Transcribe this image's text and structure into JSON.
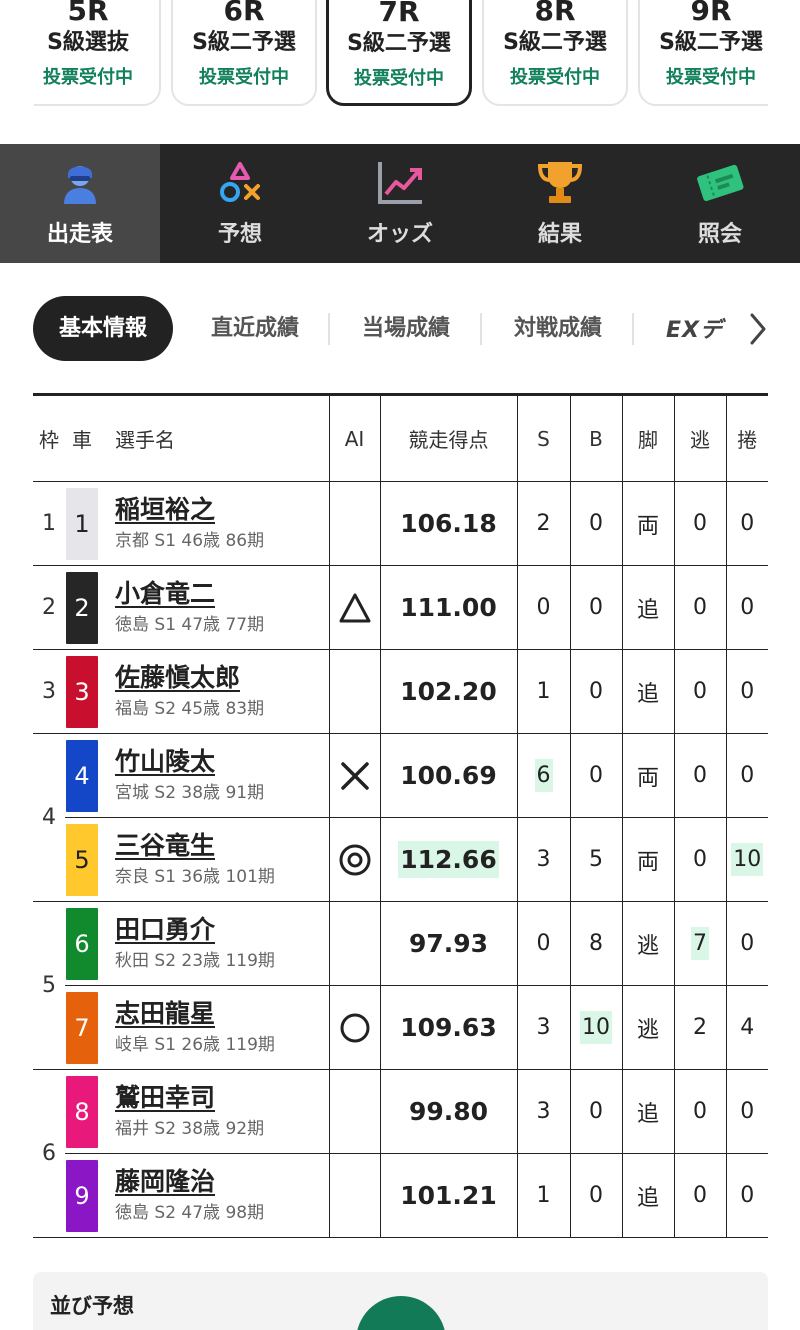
{
  "races": [
    {
      "num": "5R",
      "name": "S級選抜",
      "status": "投票受付中",
      "active": false
    },
    {
      "num": "6R",
      "name": "S級二予選",
      "status": "投票受付中",
      "active": false
    },
    {
      "num": "7R",
      "name": "S級二予選",
      "status": "投票受付中",
      "active": true
    },
    {
      "num": "8R",
      "name": "S級二予選",
      "status": "投票受付中",
      "active": false
    },
    {
      "num": "9R",
      "name": "S級二予選",
      "status": "投票受付中",
      "active": false
    }
  ],
  "nav": [
    {
      "label": "出走表",
      "icon": "racer-icon",
      "active": true
    },
    {
      "label": "予想",
      "icon": "prediction-icon",
      "active": false
    },
    {
      "label": "オッズ",
      "icon": "odds-chart-icon",
      "active": false
    },
    {
      "label": "結果",
      "icon": "trophy-icon",
      "active": false
    },
    {
      "label": "照会",
      "icon": "ticket-icon",
      "active": false
    }
  ],
  "subtabs": [
    "基本情報",
    "直近成績",
    "当場成績",
    "対戦成績",
    "EXデ"
  ],
  "table": {
    "headers": {
      "waku": "枠",
      "car": "車",
      "name": "選手名",
      "ai": "AI",
      "points": "競走得点",
      "s": "S",
      "b": "B",
      "leg": "脚",
      "escape": "逃",
      "makuri": "捲"
    },
    "rows": [
      {
        "waku": "1",
        "car": "1",
        "car_bg": "#e6e6ea",
        "car_fg": "#222222",
        "name": "稲垣裕之",
        "info": "京都 S1 46歳 86期",
        "ai": "",
        "points": "106.18",
        "s": "2",
        "b": "0",
        "leg": "両",
        "escape": "0",
        "makuri": "0"
      },
      {
        "waku": "2",
        "car": "2",
        "car_bg": "#262626",
        "car_fg": "#ffffff",
        "name": "小倉竜二",
        "info": "徳島 S1 47歳 77期",
        "ai": "△",
        "points": "111.00",
        "s": "0",
        "b": "0",
        "leg": "追",
        "escape": "0",
        "makuri": "0"
      },
      {
        "waku": "3",
        "car": "3",
        "car_bg": "#c8102e",
        "car_fg": "#ffffff",
        "name": "佐藤愼太郎",
        "info": "福島 S2 45歳 83期",
        "ai": "",
        "points": "102.20",
        "s": "1",
        "b": "0",
        "leg": "追",
        "escape": "0",
        "makuri": "0"
      },
      {
        "waku": "4",
        "car": "4",
        "car_bg": "#1446c8",
        "car_fg": "#ffffff",
        "name": "竹山陵太",
        "info": "宮城 S2 38歳 91期",
        "ai": "×",
        "points": "100.69",
        "s": "6",
        "b": "0",
        "leg": "両",
        "escape": "0",
        "makuri": "0"
      },
      {
        "waku": "4",
        "car": "5",
        "car_bg": "#ffc82c",
        "car_fg": "#222222",
        "name": "三谷竜生",
        "info": "奈良 S1 36歳 101期",
        "ai": "◎",
        "points": "112.66",
        "s": "3",
        "b": "5",
        "leg": "両",
        "escape": "0",
        "makuri": "10"
      },
      {
        "waku": "5",
        "car": "6",
        "car_bg": "#118a2e",
        "car_fg": "#ffffff",
        "name": "田口勇介",
        "info": "秋田 S2 23歳 119期",
        "ai": "",
        "points": "97.93",
        "s": "0",
        "b": "8",
        "leg": "逃",
        "escape": "7",
        "makuri": "0"
      },
      {
        "waku": "5",
        "car": "7",
        "car_bg": "#e6610c",
        "car_fg": "#ffffff",
        "name": "志田龍星",
        "info": "岐阜 S1 26歳 119期",
        "ai": "○",
        "points": "109.63",
        "s": "3",
        "b": "10",
        "leg": "逃",
        "escape": "2",
        "makuri": "4"
      },
      {
        "waku": "6",
        "car": "8",
        "car_bg": "#e8197a",
        "car_fg": "#ffffff",
        "name": "鷲田幸司",
        "info": "福井 S2 38歳 92期",
        "ai": "",
        "points": "99.80",
        "s": "3",
        "b": "0",
        "leg": "追",
        "escape": "0",
        "makuri": "0"
      },
      {
        "waku": "6",
        "car": "9",
        "car_bg": "#8a16c6",
        "car_fg": "#ffffff",
        "name": "藤岡隆治",
        "info": "徳島 S2 47歳 98期",
        "ai": "",
        "points": "101.21",
        "s": "1",
        "b": "0",
        "leg": "追",
        "escape": "0",
        "makuri": "0"
      }
    ]
  },
  "narabi": {
    "title": "並び予想"
  },
  "colors": {
    "accent_green": "#12805c",
    "highlight": "#d9f6e6",
    "nav_bg": "#262626",
    "nav_active": "#474747"
  }
}
